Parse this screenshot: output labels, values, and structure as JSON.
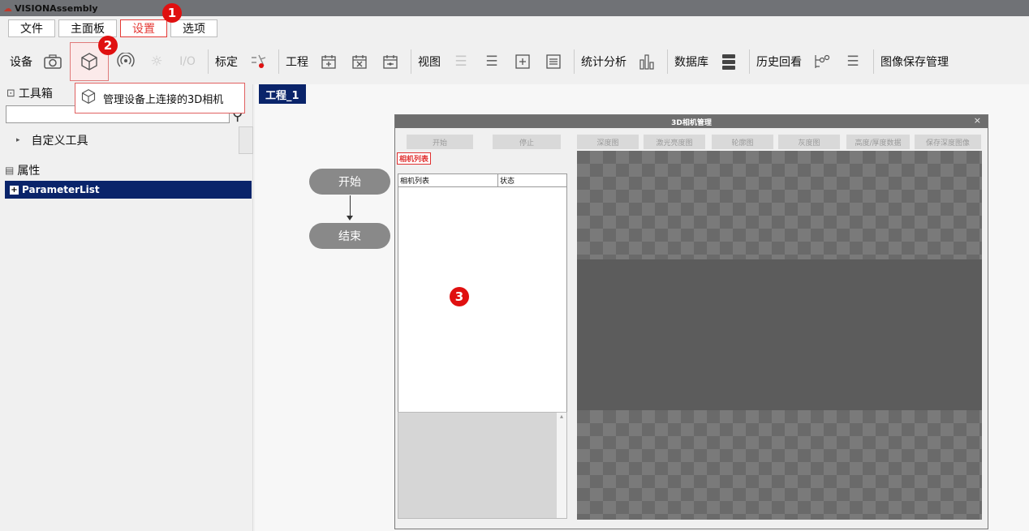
{
  "window": {
    "title": "VISIONAssembly"
  },
  "menu": {
    "tabs": [
      "文件",
      "主面板",
      "设置",
      "选项"
    ],
    "active_index": 2
  },
  "toolbar": {
    "device_label": "设备",
    "calib_label": "标定",
    "project_label": "工程",
    "view_label": "视图",
    "stats_label": "统计分析",
    "db_label": "数据库",
    "history_label": "历史回看",
    "image_save_label": "图像保存管理",
    "io_label": "I/O"
  },
  "tooltip": {
    "text": "管理设备上连接的3D相机"
  },
  "badges": {
    "b1": "1",
    "b2": "2",
    "b3": "3"
  },
  "left_panel": {
    "toolbox_title": "工具箱",
    "custom_tools": "自定义工具",
    "properties_title": "属性",
    "parameter_list": "ParameterList"
  },
  "canvas": {
    "project_tab": "工程_1",
    "flow_start": "开始",
    "flow_end": "结束"
  },
  "dialog": {
    "title": "3D相机管理",
    "close": "×",
    "buttons": [
      "开始",
      "停止",
      "深度图",
      "激光亮度图",
      "轮廓图",
      "灰度图",
      "高度/厚度数据",
      "保存深度图像"
    ],
    "camera_list_tag": "相机列表",
    "table_headers": [
      "相机列表",
      "状态"
    ]
  },
  "colors": {
    "accent_red": "#e01010",
    "selection_navy": "#0a246a"
  }
}
